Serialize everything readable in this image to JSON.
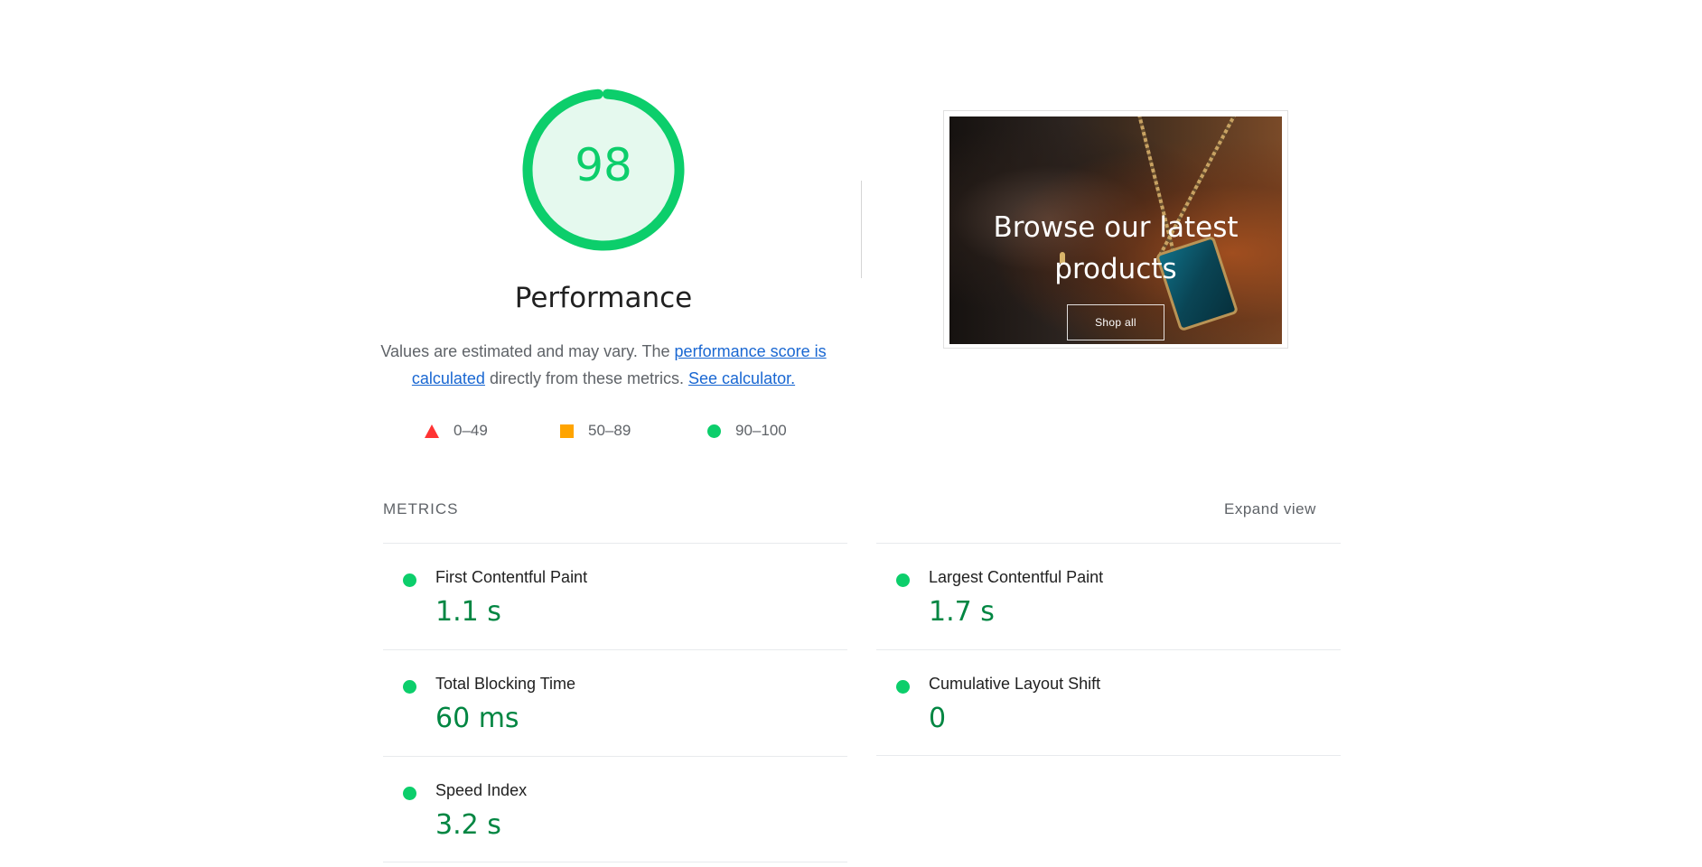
{
  "gauge": {
    "score": "98",
    "score_fraction": 0.98,
    "title": "Performance",
    "desc_prefix": "Values are estimated and may vary. The ",
    "desc_link1": "performance score is calculated",
    "desc_middle": " directly from these metrics. ",
    "desc_link2": "See calculator.",
    "color": "#0cce6b",
    "track_color": "#e5f9ee"
  },
  "scale": {
    "fail": "0–49",
    "average": "50–89",
    "pass": "90–100",
    "colors": {
      "fail": "#ff3333",
      "average": "#ffa400",
      "pass": "#0cce6b"
    }
  },
  "thumbnail": {
    "heading_line1": "Browse our latest",
    "heading_line2": "products",
    "button": "Shop all"
  },
  "metrics": {
    "header": "METRICS",
    "toggle": "Expand view",
    "value_color": "#018642",
    "items": [
      {
        "label": "First Contentful Paint",
        "value": "1.1 s"
      },
      {
        "label": "Largest Contentful Paint",
        "value": "1.7 s"
      },
      {
        "label": "Total Blocking Time",
        "value": "60 ms"
      },
      {
        "label": "Cumulative Layout Shift",
        "value": "0"
      },
      {
        "label": "Speed Index",
        "value": "3.2 s"
      }
    ]
  }
}
